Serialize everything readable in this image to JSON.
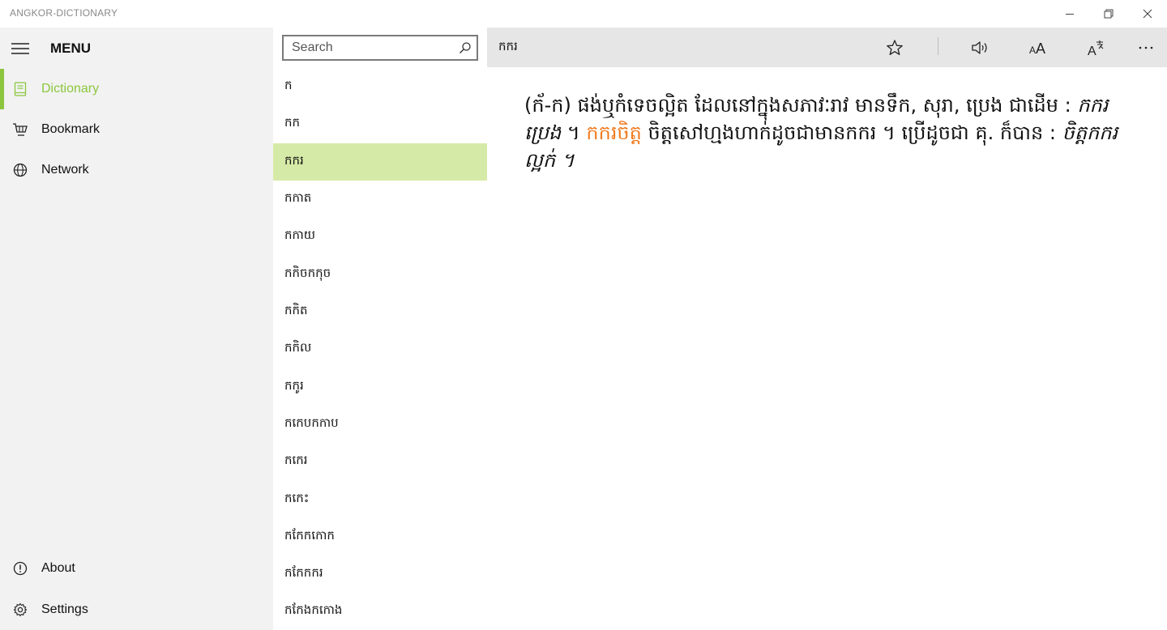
{
  "window": {
    "title": "ANGKOR-DICTIONARY",
    "controls": {
      "minimize": "minimize-icon",
      "restore": "restore-icon",
      "close": "close-icon"
    }
  },
  "sidebar": {
    "menu_label": "MENU",
    "items": [
      {
        "label": "Dictionary",
        "icon": "book-icon",
        "active": true
      },
      {
        "label": "Bookmark",
        "icon": "bookmark-basket-icon",
        "active": false
      },
      {
        "label": "Network",
        "icon": "globe-icon",
        "active": false
      }
    ],
    "bottom_items": [
      {
        "label": "About",
        "icon": "info-icon"
      },
      {
        "label": "Settings",
        "icon": "gear-icon"
      }
    ],
    "accent_color": "#8cc63e"
  },
  "search": {
    "placeholder": "Search",
    "value": ""
  },
  "word_list": {
    "selected_index": 2,
    "selected_color": "#d6eaa7",
    "items": [
      "ក",
      "កក",
      "កករ",
      "កកាត",
      "កកាយ",
      "កកិចកកុច",
      "កកិត",
      "កកិល",
      "កកូរ",
      "កកេបកកាប",
      "កកេរ",
      "កកេះ",
      "កកែកកោក",
      "កកែកករ",
      "កកែងកកោង"
    ]
  },
  "header": {
    "word": "កករ",
    "tools": [
      "star-icon",
      "speaker-icon",
      "font-size-icon",
      "translate-icon",
      "more-icon"
    ]
  },
  "definition": {
    "part1": "(ក័-ក) ផង់ឬកំទេចល្អិត ដែលនៅក្នុងសភាវៈរាវ មានទឹក, សុរា, ប្រេង ជាដើម :",
    "example1": "កករប្រេង",
    "sep1": "។",
    "highlight": "កករចិត្ត",
    "part2": "ចិត្តសៅហ្មងហាក់ដូចជាមានកករ ។ ប្រើដូចជា គុ. ក៏បាន :",
    "example2": "ចិត្តកករល្អក់ ។",
    "highlight_color": "#f07b20"
  }
}
